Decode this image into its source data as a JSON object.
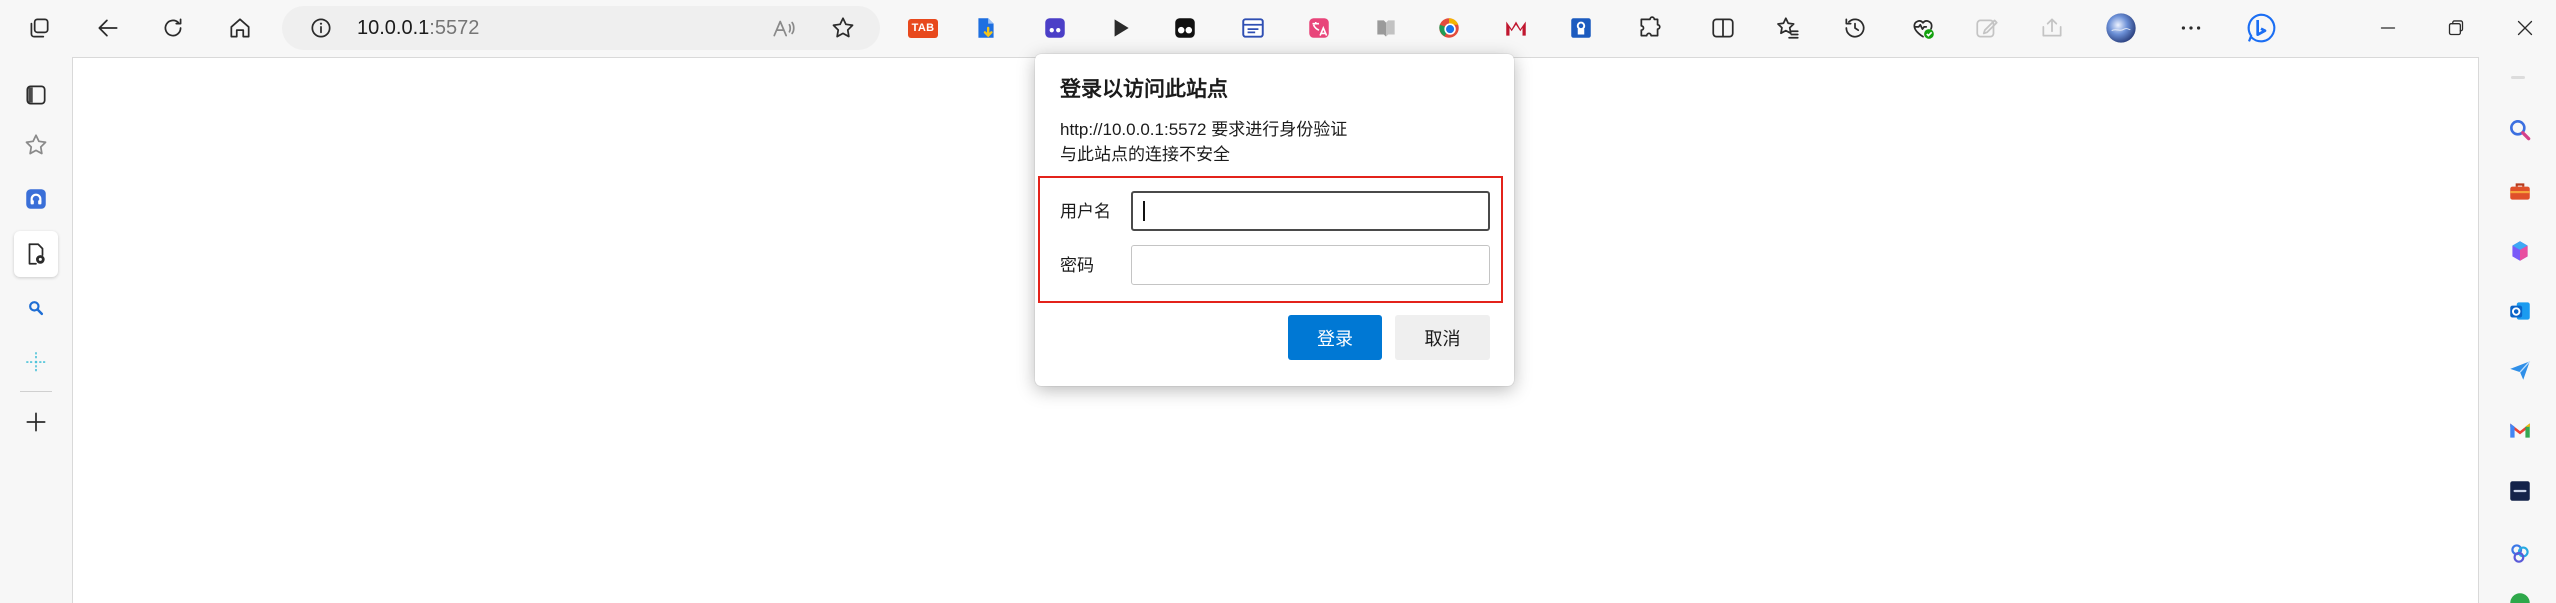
{
  "toolbar": {
    "address_host": "10.0.0.1",
    "address_port": ":5572",
    "tab_extension_label": "TAB",
    "icons": [
      "tab-actions-icon",
      "back-icon",
      "refresh-icon",
      "home-icon",
      "site-info-icon",
      "read-aloud-icon",
      "add-favorite-icon",
      "tab-extension-icon",
      "file-download-extension-icon",
      "purple-extension-icon",
      "play-extension-icon",
      "tampermonkey-icon",
      "window-extension-icon",
      "translate-extension-icon",
      "reader-extension-icon",
      "globe-extension-icon",
      "m-logo-extension-icon",
      "blue-badge-extension-icon",
      "extensions-icon",
      "split-screen-icon",
      "favorites-icon",
      "history-icon",
      "browser-essentials-icon",
      "web-capture-icon",
      "share-icon",
      "profile-avatar",
      "more-icon",
      "bing-chat-icon",
      "minimize-icon",
      "restore-icon",
      "close-icon"
    ]
  },
  "left_sidebar": {
    "icons": [
      "vertical-tabs-icon",
      "favorites-star-icon",
      "blue-app-icon",
      "page-settings-icon",
      "search-app-icon",
      "crosshair-app-icon",
      "add-icon"
    ]
  },
  "right_sidebar": {
    "icons": [
      "sidebar-hide-icon",
      "search-icon",
      "tools-icon",
      "copilot-icon",
      "outlook-icon",
      "send-icon",
      "gmail-icon",
      "dark-app-icon",
      "people-icon",
      "green-app-icon"
    ]
  },
  "dialog": {
    "title": "登录以访问此站点",
    "message": "http://10.0.0.1:5572 要求进行身份验证",
    "warning": "与此站点的连接不安全",
    "username_label": "用户名",
    "username_value": "",
    "password_label": "密码",
    "password_value": "",
    "login_button": "登录",
    "cancel_button": "取消"
  },
  "colors": {
    "accent": "#0078d4",
    "highlight_box": "#e3231b",
    "toolbar_bg": "#f7f7f7",
    "content_bg": "#ffffff"
  }
}
